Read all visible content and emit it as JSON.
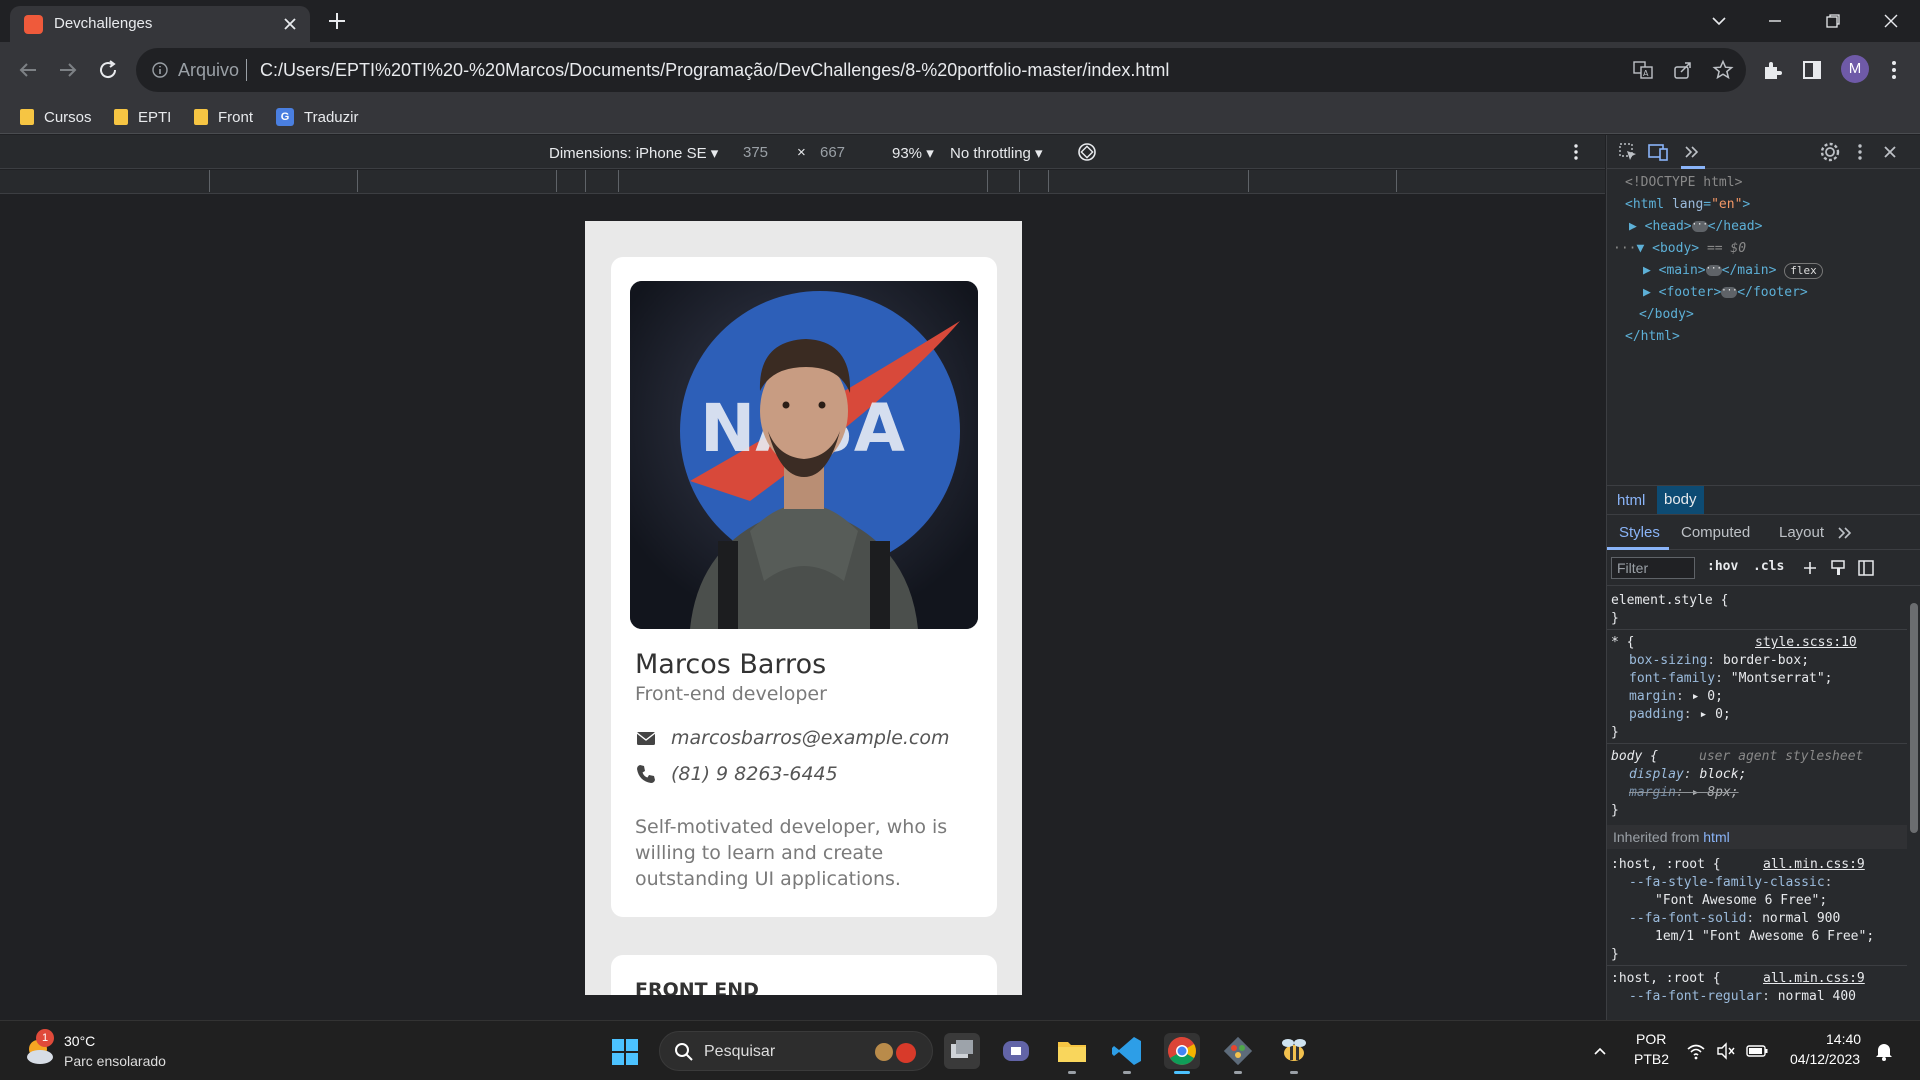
{
  "browser": {
    "tab_title": "Devchallenges",
    "omnibox": {
      "scheme_label": "Arquivo",
      "url": "C:/Users/EPTI%20TI%20-%20Marcos/Documents/Programação/DevChallenges/8-%20portfolio-master/index.html"
    },
    "avatar_letter": "M",
    "bookmarks": [
      {
        "label": "Cursos",
        "icon": "folder-icon"
      },
      {
        "label": "EPTI",
        "icon": "folder-icon"
      },
      {
        "label": "Front",
        "icon": "folder-icon"
      },
      {
        "label": "Traduzir",
        "icon": "google-translate-icon"
      }
    ]
  },
  "device_toolbar": {
    "dimensions_label": "Dimensions: iPhone SE",
    "width": "375",
    "times": "×",
    "height": "667",
    "zoom": "93%",
    "throttling": "No throttling"
  },
  "page": {
    "name": "Marcos Barros",
    "role": "Front-end developer",
    "email": "marcosbarros@example.com",
    "phone": "(81) 9 8263-6445",
    "bio": "Self-motivated developer, who is willing to learn and create outstanding UI applications.",
    "section_heading": "FRONT END",
    "photo_alt": "Photo of a young man in a grey hoodie in front of a NASA logo",
    "nasa_text": "NASA"
  },
  "devtools": {
    "dom": {
      "doctype": "<!DOCTYPE html>",
      "html_open_tag": "html",
      "html_attr": "lang",
      "html_attr_val": "\"en\"",
      "head": "head",
      "body": "body",
      "body_sel": "== $0",
      "main": "main",
      "main_badge": "flex",
      "footer": "footer",
      "body_close": "</body>",
      "html_close": "</html>"
    },
    "breadcrumbs": [
      "html",
      "body"
    ],
    "pane_tabs": [
      "Styles",
      "Computed",
      "Layout"
    ],
    "filter_placeholder": "Filter",
    "hov": ":hov",
    "cls": ".cls",
    "rules": {
      "element_style": "element.style {",
      "close": "}",
      "star_sel": "* {",
      "star_src": "style.scss:10",
      "box_sizing_p": "box-sizing",
      "box_sizing_v": "border-box;",
      "font_family_p": "font-family",
      "font_family_v": "\"Montserrat\";",
      "margin_p": "margin",
      "margin_v": "0;",
      "padding_p": "padding",
      "padding_v": "0;",
      "body_sel": "body {",
      "ua_label": "user agent stylesheet",
      "display_p": "display",
      "display_v": "block;",
      "body_margin_p": "margin",
      "body_margin_v": "8px;",
      "inherited_label": "Inherited from",
      "inherited_from": "html",
      "host_sel": ":host, :root {",
      "host_src": "all.min.css:9",
      "fa_family_p": "--fa-style-family-classic",
      "fa_family_v": "\"Font Awesome 6 Free\";",
      "fa_solid_p": "--fa-font-solid",
      "fa_solid_v1": "normal 900",
      "fa_solid_v2": "1em/1 \"Font Awesome 6 Free\";",
      "host_sel2": ":host, :root {",
      "host_src2": "all.min.css:9",
      "fa_regular_p": "--fa-font-regular",
      "fa_regular_v": "normal 400"
    }
  },
  "taskbar": {
    "weather_temp": "30°C",
    "weather_desc": "Parc ensolarado",
    "weather_badge": "1",
    "search_label": "Pesquisar",
    "lang_top": "POR",
    "lang_bottom": "PTB2",
    "time": "14:40",
    "date": "04/12/2023"
  },
  "colors": {
    "accent": "#8ab4f8",
    "favicon": "#ef5a3b",
    "page_bg": "#e9e9e9"
  }
}
